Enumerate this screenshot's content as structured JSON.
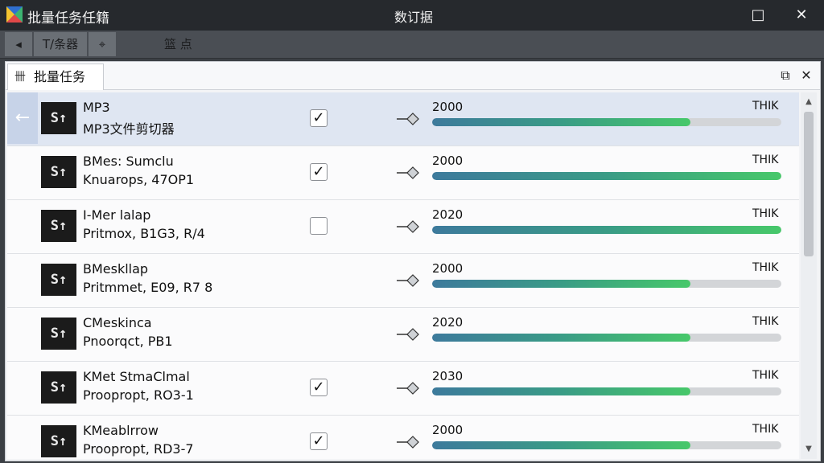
{
  "window": {
    "title": "批量任务任籍",
    "center_title": "数订据",
    "minimize_glyph": "□",
    "close_glyph": "✕"
  },
  "toolbar": {
    "dropdown_glyph": "◂",
    "filter_label": "T/条器",
    "pin_glyph": "⌖",
    "right_label": "篮  点"
  },
  "tab": {
    "icon_glyph": "卌",
    "label": "批量任务"
  },
  "panel": {
    "restore_glyph": "⧉",
    "close_glyph": "✕"
  },
  "rows": [
    {
      "line1": "MP3",
      "line2": "MP3文件剪切器",
      "checked": true,
      "year": "2000",
      "right": "THIK",
      "progress": 0.74
    },
    {
      "line1": "BMes: Sumclu",
      "line2": "Knuarops, 47OP1",
      "checked": true,
      "year": "2000",
      "right": "THIK",
      "progress": 1.0
    },
    {
      "line1": "I-Mer lalap",
      "line2": "Pritmox, B1G3, R/4",
      "checked": false,
      "year": "2020",
      "right": "THIK",
      "progress": 1.0
    },
    {
      "line1": "BMeskllap",
      "line2": "Pritmmet, E09, R7 8",
      "checked": null,
      "year": "2000",
      "right": "THIK",
      "progress": 0.74
    },
    {
      "line1": "CMeskinca",
      "line2": "Pnoorqct, PB1",
      "checked": null,
      "year": "2020",
      "right": "THIK",
      "progress": 0.74
    },
    {
      "line1": "KMet StmaClmal",
      "line2": "Proopropt, RO3-1",
      "checked": true,
      "year": "2030",
      "right": "THIK",
      "progress": 0.74
    },
    {
      "line1": "KMeablrrow",
      "line2": "Proopropt, RD3-7",
      "checked": true,
      "year": "2000",
      "right": "THIK",
      "progress": 0.74
    }
  ],
  "thumb_glyph": "S↑",
  "selected_row": 0,
  "colors": {
    "accent": "#c7d3e8",
    "progress_start": "#3d7a9c",
    "progress_end": "#47c86a"
  }
}
